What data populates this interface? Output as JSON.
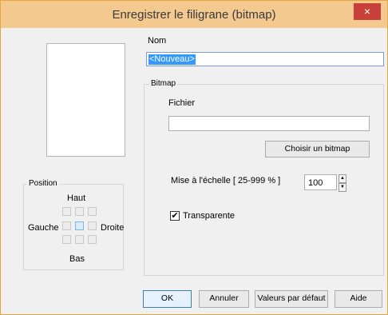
{
  "window": {
    "title": "Enregistrer le filigrane (bitmap)",
    "close_glyph": "×"
  },
  "name": {
    "label": "Nom",
    "value": "<Nouveau>"
  },
  "bitmap": {
    "group_label": "Bitmap",
    "file_label": "Fichier",
    "file_value": "",
    "choose_button": "Choisir un bitmap",
    "scale_label": "Mise à l'échelle [ 25-999 % ]",
    "scale_value": "100",
    "transparent_label": "Transparente",
    "transparent_checked": true
  },
  "position": {
    "group_label": "Position",
    "top": "Haut",
    "left": "Gauche",
    "right": "Droite",
    "bottom": "Bas",
    "selected_cell": "center"
  },
  "buttons": {
    "ok": "OK",
    "cancel": "Annuler",
    "defaults": "Valeurs par défaut",
    "help": "Aide"
  }
}
